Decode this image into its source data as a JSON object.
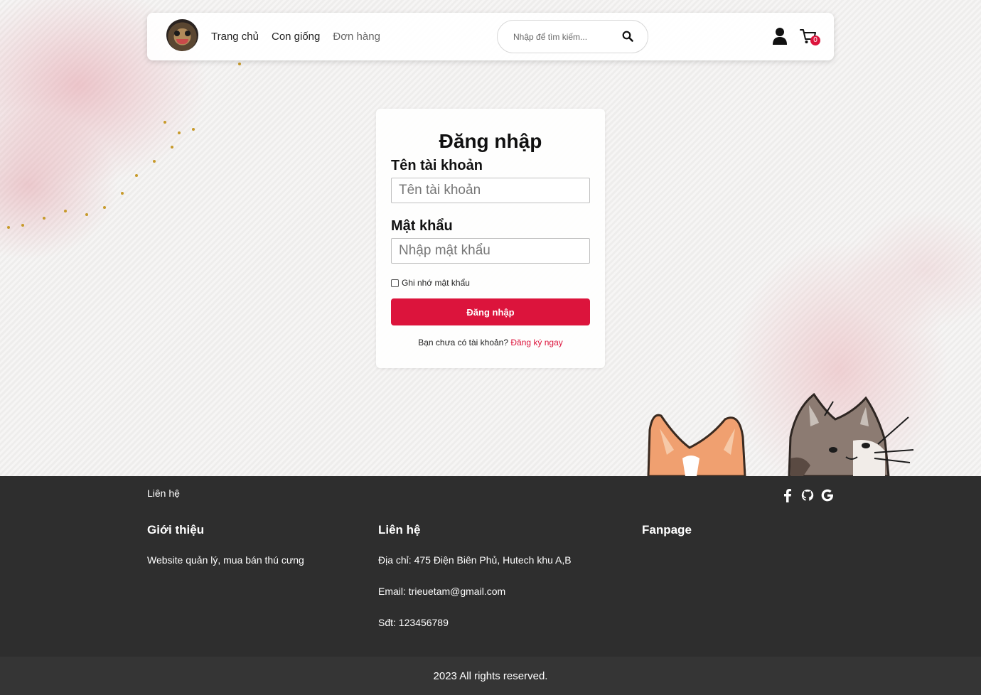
{
  "header": {
    "nav": [
      "Trang chủ",
      "Con giống",
      "Đơn hàng"
    ],
    "search_placeholder": "Nhập để tìm kiếm...",
    "cart_count": "0"
  },
  "login": {
    "title": "Đăng nhập",
    "username_label": "Tên tài khoản",
    "username_placeholder": "Tên tài khoản",
    "password_label": "Mật khẩu",
    "password_placeholder": "Nhập mật khẩu",
    "remember_label": "Ghi nhớ mật khẩu",
    "submit_label": "Đăng nhập",
    "register_prompt": "Bạn chưa có tài khoản?",
    "register_link": "Đăng ký ngay"
  },
  "footer": {
    "contact_link": "Liên hệ",
    "intro": {
      "heading": "Giới thiệu",
      "text": "Website quản lý, mua bán thú cưng"
    },
    "contact": {
      "heading": "Liên hệ",
      "address": "Địa chỉ: 475 Điện Biên Phủ, Hutech khu A,B",
      "email": "Email: trieuetam@gmail.com",
      "phone": "Sđt: 123456789"
    },
    "fanpage": {
      "heading": "Fanpage"
    },
    "socials": [
      "facebook-icon",
      "github-icon",
      "google-icon"
    ],
    "copyright": "2023 All rights reserved."
  },
  "colors": {
    "accent": "#dc143c",
    "footer": "#2e2e2e",
    "copyright_bar": "#353535"
  }
}
